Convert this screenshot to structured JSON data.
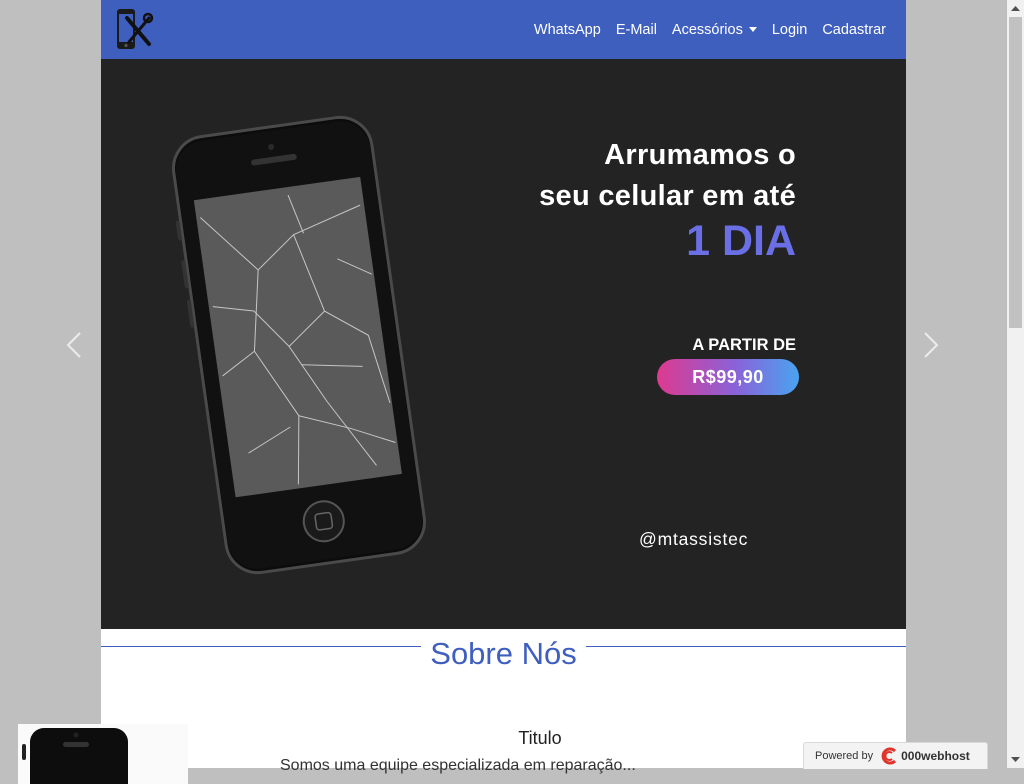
{
  "navbar": {
    "brand_icon": "phone-repair-icon",
    "links": [
      "WhatsApp",
      "E-Mail",
      "Acessórios",
      "Login",
      "Cadastrar"
    ]
  },
  "hero": {
    "headline_line1": "Arrumamos o",
    "headline_line2": "seu celular em até",
    "headline_accent": "1 DIA",
    "price_label": "A PARTIR DE",
    "price": "R$99,90",
    "handle": "@mtassistec",
    "accent_color": "#6b6fe6"
  },
  "about": {
    "title": "Sobre Nós",
    "card_title": "Titulo",
    "card_text": "Somos uma equipe especializada em reparação..."
  },
  "badge": {
    "powered": "Powered by",
    "brand": "000webhost"
  }
}
